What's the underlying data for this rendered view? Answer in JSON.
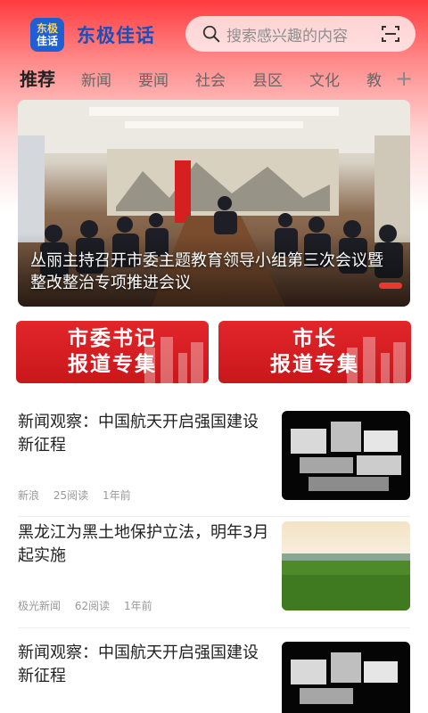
{
  "app": {
    "logo_line1": "东极",
    "logo_line2": "佳话",
    "name": "东极佳话"
  },
  "search": {
    "placeholder": "搜索感兴趣的内容"
  },
  "tabs": [
    {
      "label": "推荐"
    },
    {
      "label": "新闻"
    },
    {
      "label": "要闻"
    },
    {
      "label": "社会"
    },
    {
      "label": "县区"
    },
    {
      "label": "文化"
    },
    {
      "label": "教"
    }
  ],
  "tabs_add": "+",
  "hero": {
    "caption": "丛丽主持召开市委主题教育领导小组第三次会议暨整改整治专项推进会议"
  },
  "banners": [
    {
      "line1": "市委书记",
      "line2": "报道专集"
    },
    {
      "line1": "市长",
      "line2": "报道专集"
    }
  ],
  "news": [
    {
      "title": "新闻观察：中国航天开启强国建设新征程",
      "source": "新浪",
      "reads": "25阅读",
      "time": "1年前"
    },
    {
      "title": "黑龙江为黑土地保护立法，明年3月起实施",
      "source": "极光新闻",
      "reads": "62阅读",
      "time": "1年前"
    },
    {
      "title": "新闻观察：中国航天开启强国建设新征程"
    }
  ],
  "colors": {
    "brand_blue": "#1b4fb8",
    "accent_red": "#e2262a"
  }
}
